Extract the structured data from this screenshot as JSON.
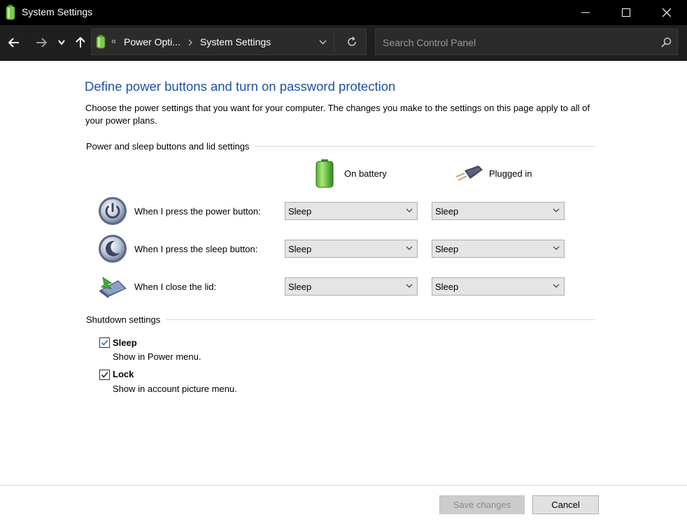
{
  "window": {
    "title": "System Settings"
  },
  "address": {
    "overflow_label": "«",
    "crumbs": [
      "Power Opti...",
      "System Settings"
    ],
    "search_placeholder": "Search Control Panel"
  },
  "page": {
    "heading": "Define power buttons and turn on password protection",
    "description": "Choose the power settings that you want for your computer. The changes you make to the settings on this page apply to all of your power plans."
  },
  "buttons_section": {
    "title": "Power and sleep buttons and lid settings",
    "columns": [
      "On battery",
      "Plugged in"
    ],
    "rows": [
      {
        "label": "When I press the power button:",
        "battery": "Sleep",
        "plugged": "Sleep"
      },
      {
        "label": "When I press the sleep button:",
        "battery": "Sleep",
        "plugged": "Sleep"
      },
      {
        "label": "When I close the lid:",
        "battery": "Sleep",
        "plugged": "Sleep"
      }
    ]
  },
  "shutdown_section": {
    "title": "Shutdown settings",
    "items": [
      {
        "title": "Sleep",
        "description": "Show in Power menu.",
        "checked": true
      },
      {
        "title": "Lock",
        "description": "Show in account picture menu.",
        "checked": true
      }
    ]
  },
  "footer": {
    "save_label": "Save changes",
    "cancel_label": "Cancel"
  },
  "colors": {
    "heading": "#1e50a2",
    "checkbox_check": "#0063b1",
    "titlebar": "#000000"
  },
  "icons": {
    "app": "battery-icon",
    "back": "arrow-left-icon",
    "forward": "arrow-right-icon",
    "recent": "chevron-down-icon",
    "up": "arrow-up-icon",
    "refresh": "refresh-icon",
    "search": "search-icon"
  }
}
